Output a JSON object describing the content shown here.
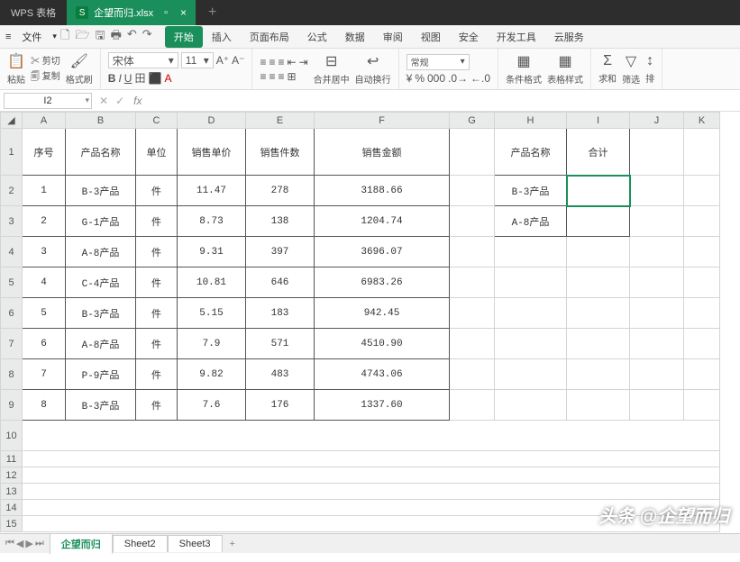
{
  "app_name": "WPS 表格",
  "doc_tab": {
    "filename": "企望而归.xlsx"
  },
  "menubar": {
    "file": "文件",
    "tabs": [
      "开始",
      "插入",
      "页面布局",
      "公式",
      "数据",
      "审阅",
      "视图",
      "安全",
      "开发工具",
      "云服务"
    ],
    "active": "开始"
  },
  "ribbon": {
    "paste": "粘贴",
    "cut": "剪切",
    "copy": "复制",
    "format_painter": "格式刷",
    "font_name": "宋体",
    "font_size": "11",
    "merge_center": "合并居中",
    "wrap_text": "自动换行",
    "number_format": "常规",
    "cond_format": "条件格式",
    "table_style": "表格样式",
    "sum": "求和",
    "filter": "筛选",
    "sort": "排"
  },
  "namebox": "I2",
  "fx": "fx",
  "columns": [
    "A",
    "B",
    "C",
    "D",
    "E",
    "F",
    "G",
    "H",
    "I",
    "J",
    "K"
  ],
  "headers": {
    "seq": "序号",
    "pname": "产品名称",
    "unit": "单位",
    "price": "销售单价",
    "qty": "销售件数",
    "amount": "销售金额",
    "pname2": "产品名称",
    "total": "合计"
  },
  "rows": [
    {
      "seq": "1",
      "pname": "B-3产品",
      "unit": "件",
      "price": "11.47",
      "qty": "278",
      "amount": "3188.66"
    },
    {
      "seq": "2",
      "pname": "G-1产品",
      "unit": "件",
      "price": "8.73",
      "qty": "138",
      "amount": "1204.74"
    },
    {
      "seq": "3",
      "pname": "A-8产品",
      "unit": "件",
      "price": "9.31",
      "qty": "397",
      "amount": "3696.07"
    },
    {
      "seq": "4",
      "pname": "C-4产品",
      "unit": "件",
      "price": "10.81",
      "qty": "646",
      "amount": "6983.26"
    },
    {
      "seq": "5",
      "pname": "B-3产品",
      "unit": "件",
      "price": "5.15",
      "qty": "183",
      "amount": "942.45"
    },
    {
      "seq": "6",
      "pname": "A-8产品",
      "unit": "件",
      "price": "7.9",
      "qty": "571",
      "amount": "4510.90"
    },
    {
      "seq": "7",
      "pname": "P-9产品",
      "unit": "件",
      "price": "9.82",
      "qty": "483",
      "amount": "4743.06"
    },
    {
      "seq": "8",
      "pname": "B-3产品",
      "unit": "件",
      "price": "7.6",
      "qty": "176",
      "amount": "1337.60"
    }
  ],
  "side": [
    "B-3产品",
    "A-8产品"
  ],
  "sheet_tabs": [
    "企望而归",
    "Sheet2",
    "Sheet3"
  ],
  "watermark": "头条 @企望而归"
}
